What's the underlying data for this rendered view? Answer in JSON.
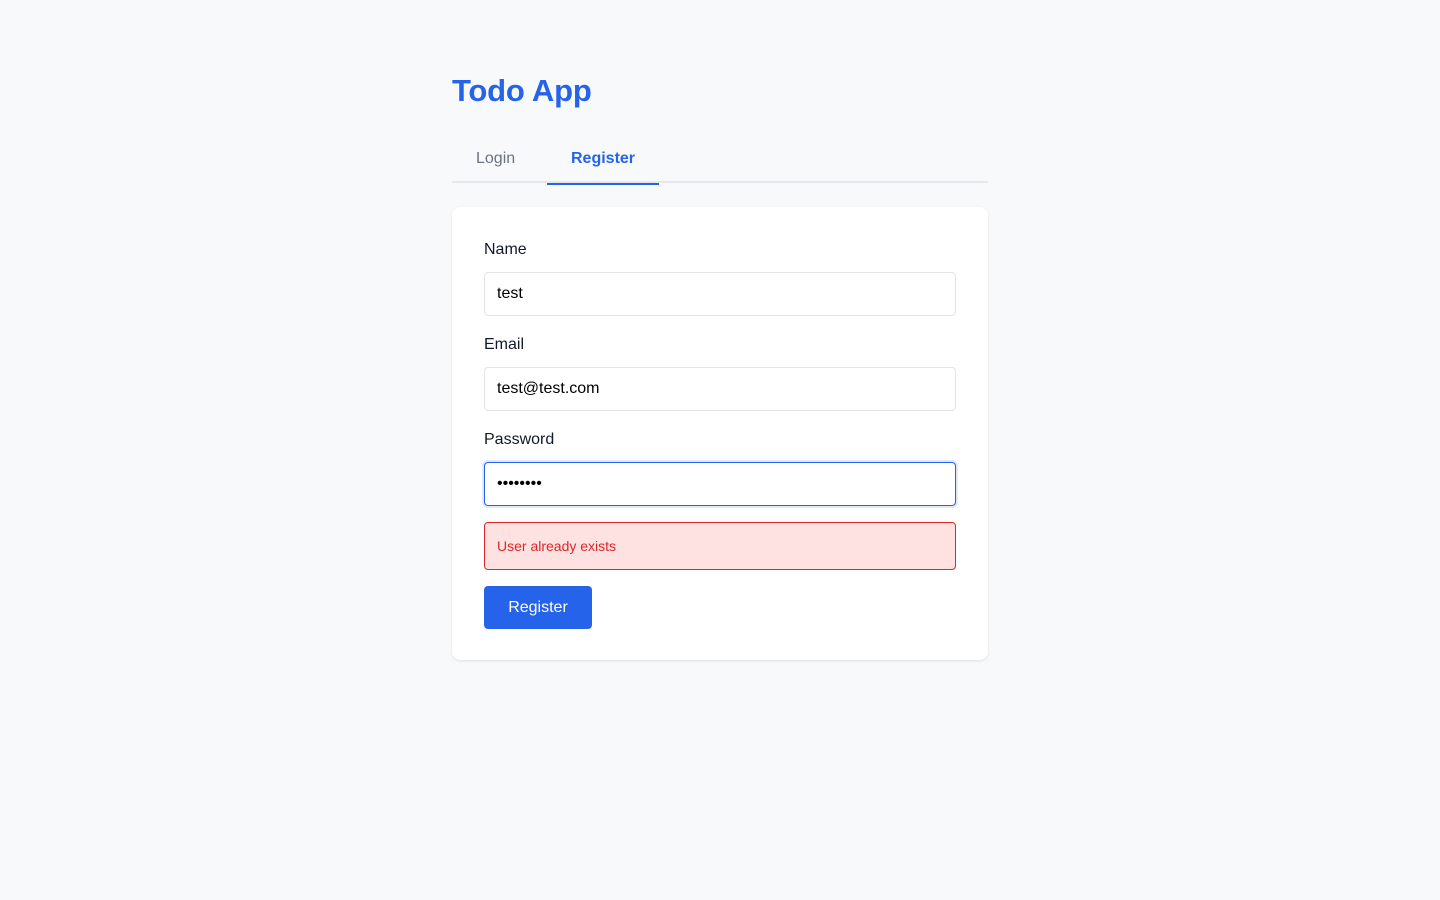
{
  "app": {
    "title": "Todo App"
  },
  "tabs": [
    {
      "label": "Login",
      "active": false
    },
    {
      "label": "Register",
      "active": true
    }
  ],
  "form": {
    "name": {
      "label": "Name",
      "value": "test"
    },
    "email": {
      "label": "Email",
      "value": "test@test.com"
    },
    "password": {
      "label": "Password",
      "value": "password"
    },
    "error": "User already exists",
    "submit_label": "Register"
  },
  "colors": {
    "accent": "#2563eb",
    "error_text": "#dc2626",
    "error_bg": "#fee2e2",
    "background": "#f8f9fb"
  }
}
